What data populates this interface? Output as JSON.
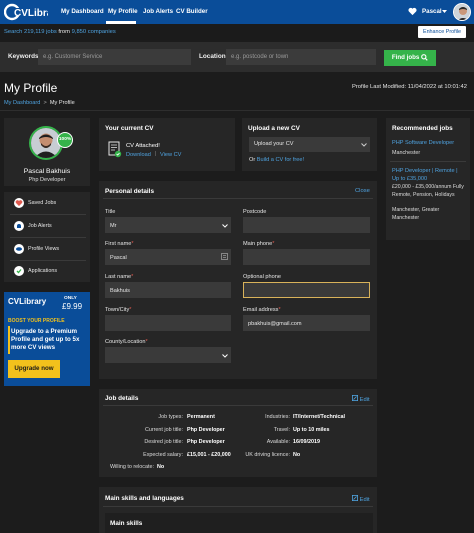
{
  "nav": {
    "brand": "CVLibrary",
    "items": [
      "My Dashboard",
      "My Profile",
      "Job Alerts",
      "CV Builder"
    ],
    "user": "Pascal"
  },
  "search_strip": {
    "jobs_link": "Search 219,119 jobs",
    "from": "from",
    "companies_link": "9,850 companies",
    "enhance": "Enhance Profile"
  },
  "search_form": {
    "keywords_label": "Keywords",
    "keywords_placeholder": "e.g. Customer Service",
    "location_label": "Location",
    "location_placeholder": "e.g. postcode or town",
    "find_button": "Find jobs"
  },
  "header": {
    "title": "My Profile",
    "last_modified": "Profile Last Modified: 11/04/2022 at 10:01:42"
  },
  "breadcrumb": {
    "home": "My Dashboard",
    "current": "My Profile"
  },
  "profile_card": {
    "completion": "100%",
    "name": "Pascal Bakhuis",
    "job_title": "Php Developer"
  },
  "side_menu": [
    "Saved Jobs",
    "Job Alerts",
    "Profile Views",
    "Applications"
  ],
  "promo": {
    "brand": "CVLibrary",
    "only": "ONLY",
    "price": "£9.99",
    "boost": "BOOST YOUR PROFILE",
    "headline": "Upgrade to a Premium Profile and get up to 5x more CV views",
    "button": "Upgrade now"
  },
  "current_cv": {
    "title": "Your current CV",
    "attached": "CV Attached!",
    "download": "Download",
    "view": "View CV"
  },
  "upload_cv": {
    "title": "Upload a new CV",
    "select_value": "Upload your CV",
    "or": "Or",
    "build_link": "Build a CV for free!"
  },
  "recommended": {
    "title": "Recommended jobs",
    "jobs": [
      {
        "title": "PHP Software Developer",
        "location": "Manchester",
        "salary": "",
        "location2": ""
      },
      {
        "title": "PHP Developer | Remote | Up to £35,000",
        "location": "",
        "salary": "£20,000 - £35,000/annum Fully Remote, Pension, Holidays",
        "location2": "Manchester, Greater Manchester"
      }
    ]
  },
  "personal": {
    "title": "Personal details",
    "close": "Close",
    "title_label": "Title",
    "title_value": "Mr",
    "postcode_label": "Postcode",
    "firstname_label": "First name",
    "firstname_value": "Pascal",
    "mainphone_label": "Main phone",
    "lastname_label": "Last name",
    "lastname_value": "Bakhuis",
    "optphone_label": "Optional phone",
    "town_label": "Town/City",
    "email_label": "Email address",
    "email_value": "pbakhuis@gmail.com",
    "county_label": "County/Location",
    "required_mark": "*"
  },
  "job_details": {
    "title": "Job details",
    "edit": "Edit",
    "left": [
      {
        "label": "Job types:",
        "value": "Permanent"
      },
      {
        "label": "Current job title:",
        "value": "Php Developer"
      },
      {
        "label": "Desired job title:",
        "value": "Php Developer"
      },
      {
        "label": "Expected salary:",
        "value": "£15,001 - £20,000"
      },
      {
        "label": "Willing to relocate:",
        "value": "No"
      }
    ],
    "right": [
      {
        "label": "Industries:",
        "value": "IT/Internet/Technical"
      },
      {
        "label": "Travel:",
        "value": "Up to 10 miles"
      },
      {
        "label": "Available:",
        "value": "16/09/2019"
      },
      {
        "label": "UK driving licence:",
        "value": "No"
      }
    ]
  },
  "skills": {
    "title": "Main skills and languages",
    "edit": "Edit",
    "main_skills": "Main skills"
  },
  "colors": {
    "brand_blue": "#0a4d99",
    "green": "#35b34a",
    "link": "#4fa3e0",
    "promo_yellow": "#f2c11c"
  }
}
